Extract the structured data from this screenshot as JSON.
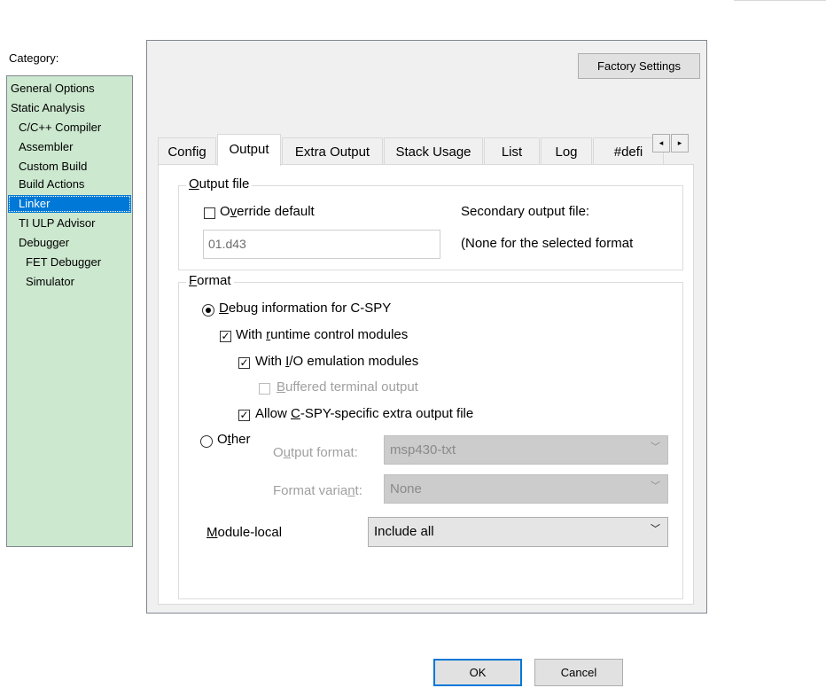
{
  "category": {
    "label": "Category:",
    "items": [
      {
        "label": "General Options",
        "level": 0,
        "selected": false
      },
      {
        "label": "Static Analysis",
        "level": 0,
        "selected": false
      },
      {
        "label": "C/C++ Compiler",
        "level": 1,
        "selected": false
      },
      {
        "label": "Assembler",
        "level": 1,
        "selected": false
      },
      {
        "label": "Custom Build",
        "level": 1,
        "selected": false
      },
      {
        "label": "Build Actions",
        "level": 1,
        "selected": false
      },
      {
        "label": "Linker",
        "level": 1,
        "selected": true
      },
      {
        "label": "TI ULP Advisor",
        "level": 1,
        "selected": false
      },
      {
        "label": "Debugger",
        "level": 1,
        "selected": false
      },
      {
        "label": "FET Debugger",
        "level": 2,
        "selected": false
      },
      {
        "label": "Simulator",
        "level": 2,
        "selected": false
      }
    ],
    "background_color": "#cce8cf",
    "selected_color": "#0078d7"
  },
  "main": {
    "factory_settings_label": "Factory Settings",
    "tabs": [
      {
        "label": "Config",
        "active": false
      },
      {
        "label": "Output",
        "active": true
      },
      {
        "label": "Extra Output",
        "active": false
      },
      {
        "label": "Stack Usage",
        "active": false
      },
      {
        "label": "List",
        "active": false
      },
      {
        "label": "Log",
        "active": false
      },
      {
        "label": "#defi",
        "active": false
      }
    ],
    "tab_scroll": {
      "left_icon": "triangle-left-icon",
      "right_icon": "triangle-right-icon",
      "left_glyph": "◂",
      "right_glyph": "▸"
    },
    "output_file": {
      "title": "Output file",
      "override_default_label": "Override default",
      "override_default_checked": false,
      "filename_value": "01.d43",
      "secondary_label": "Secondary output file:",
      "secondary_value": "(None for the selected format"
    },
    "format": {
      "title": "Format",
      "debug_info_label": "Debug information for C-SPY",
      "debug_info_selected": true,
      "runtime_control_label": "With runtime control modules",
      "runtime_control_checked": true,
      "io_emulation_label": "With I/O emulation modules",
      "io_emulation_checked": true,
      "buffered_terminal_label": "Buffered terminal output",
      "buffered_terminal_checked": false,
      "allow_cspy_label": "Allow C-SPY-specific extra output file",
      "allow_cspy_checked": true,
      "other_label": "Other",
      "other_selected": false,
      "output_format_label": "Output format:",
      "output_format_value": "msp430-txt",
      "format_variant_label": "Format variant:",
      "format_variant_value": "None",
      "module_local_label": "Module-local",
      "module_local_value": "Include all"
    }
  },
  "footer": {
    "ok_label": "OK",
    "cancel_label": "Cancel"
  }
}
